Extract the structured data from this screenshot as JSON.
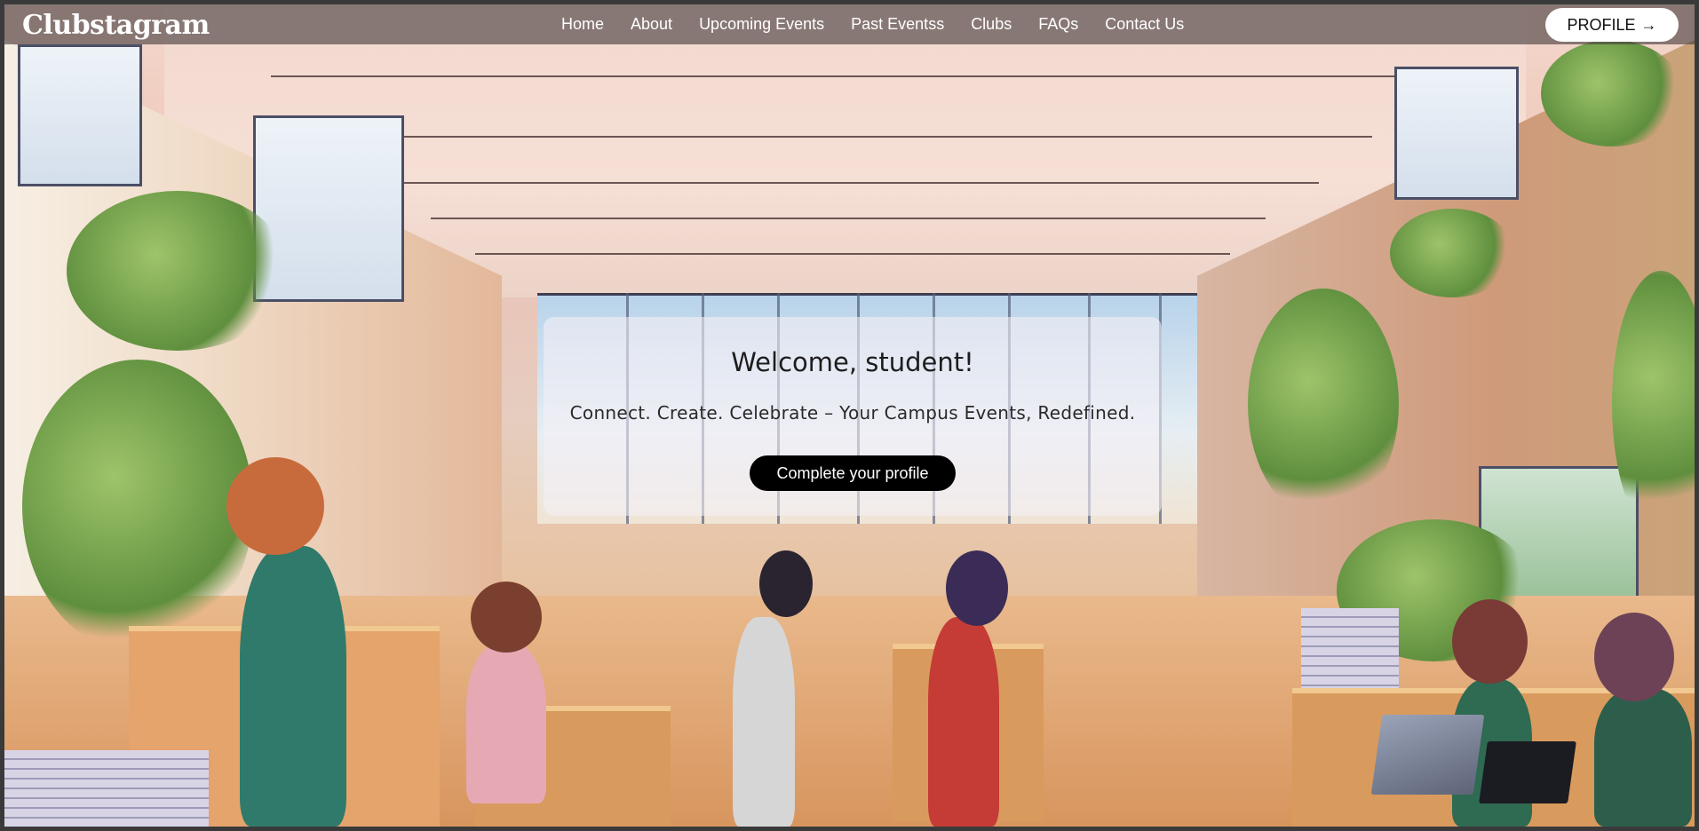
{
  "navbar": {
    "brand": "Clubstagram",
    "links": [
      {
        "label": "Home"
      },
      {
        "label": "About"
      },
      {
        "label": "Upcoming Events"
      },
      {
        "label": "Past Eventss"
      },
      {
        "label": "Clubs"
      },
      {
        "label": "FAQs"
      },
      {
        "label": "Contact Us"
      }
    ],
    "profile_label": "PROFILE",
    "profile_icon": "→"
  },
  "hero": {
    "title": "Welcome, student!",
    "subtitle": "Connect. Create. Celebrate – Your Campus Events, Redefined.",
    "cta_label": "Complete your profile"
  },
  "background": {
    "icon": "campus-classroom-illustration"
  }
}
